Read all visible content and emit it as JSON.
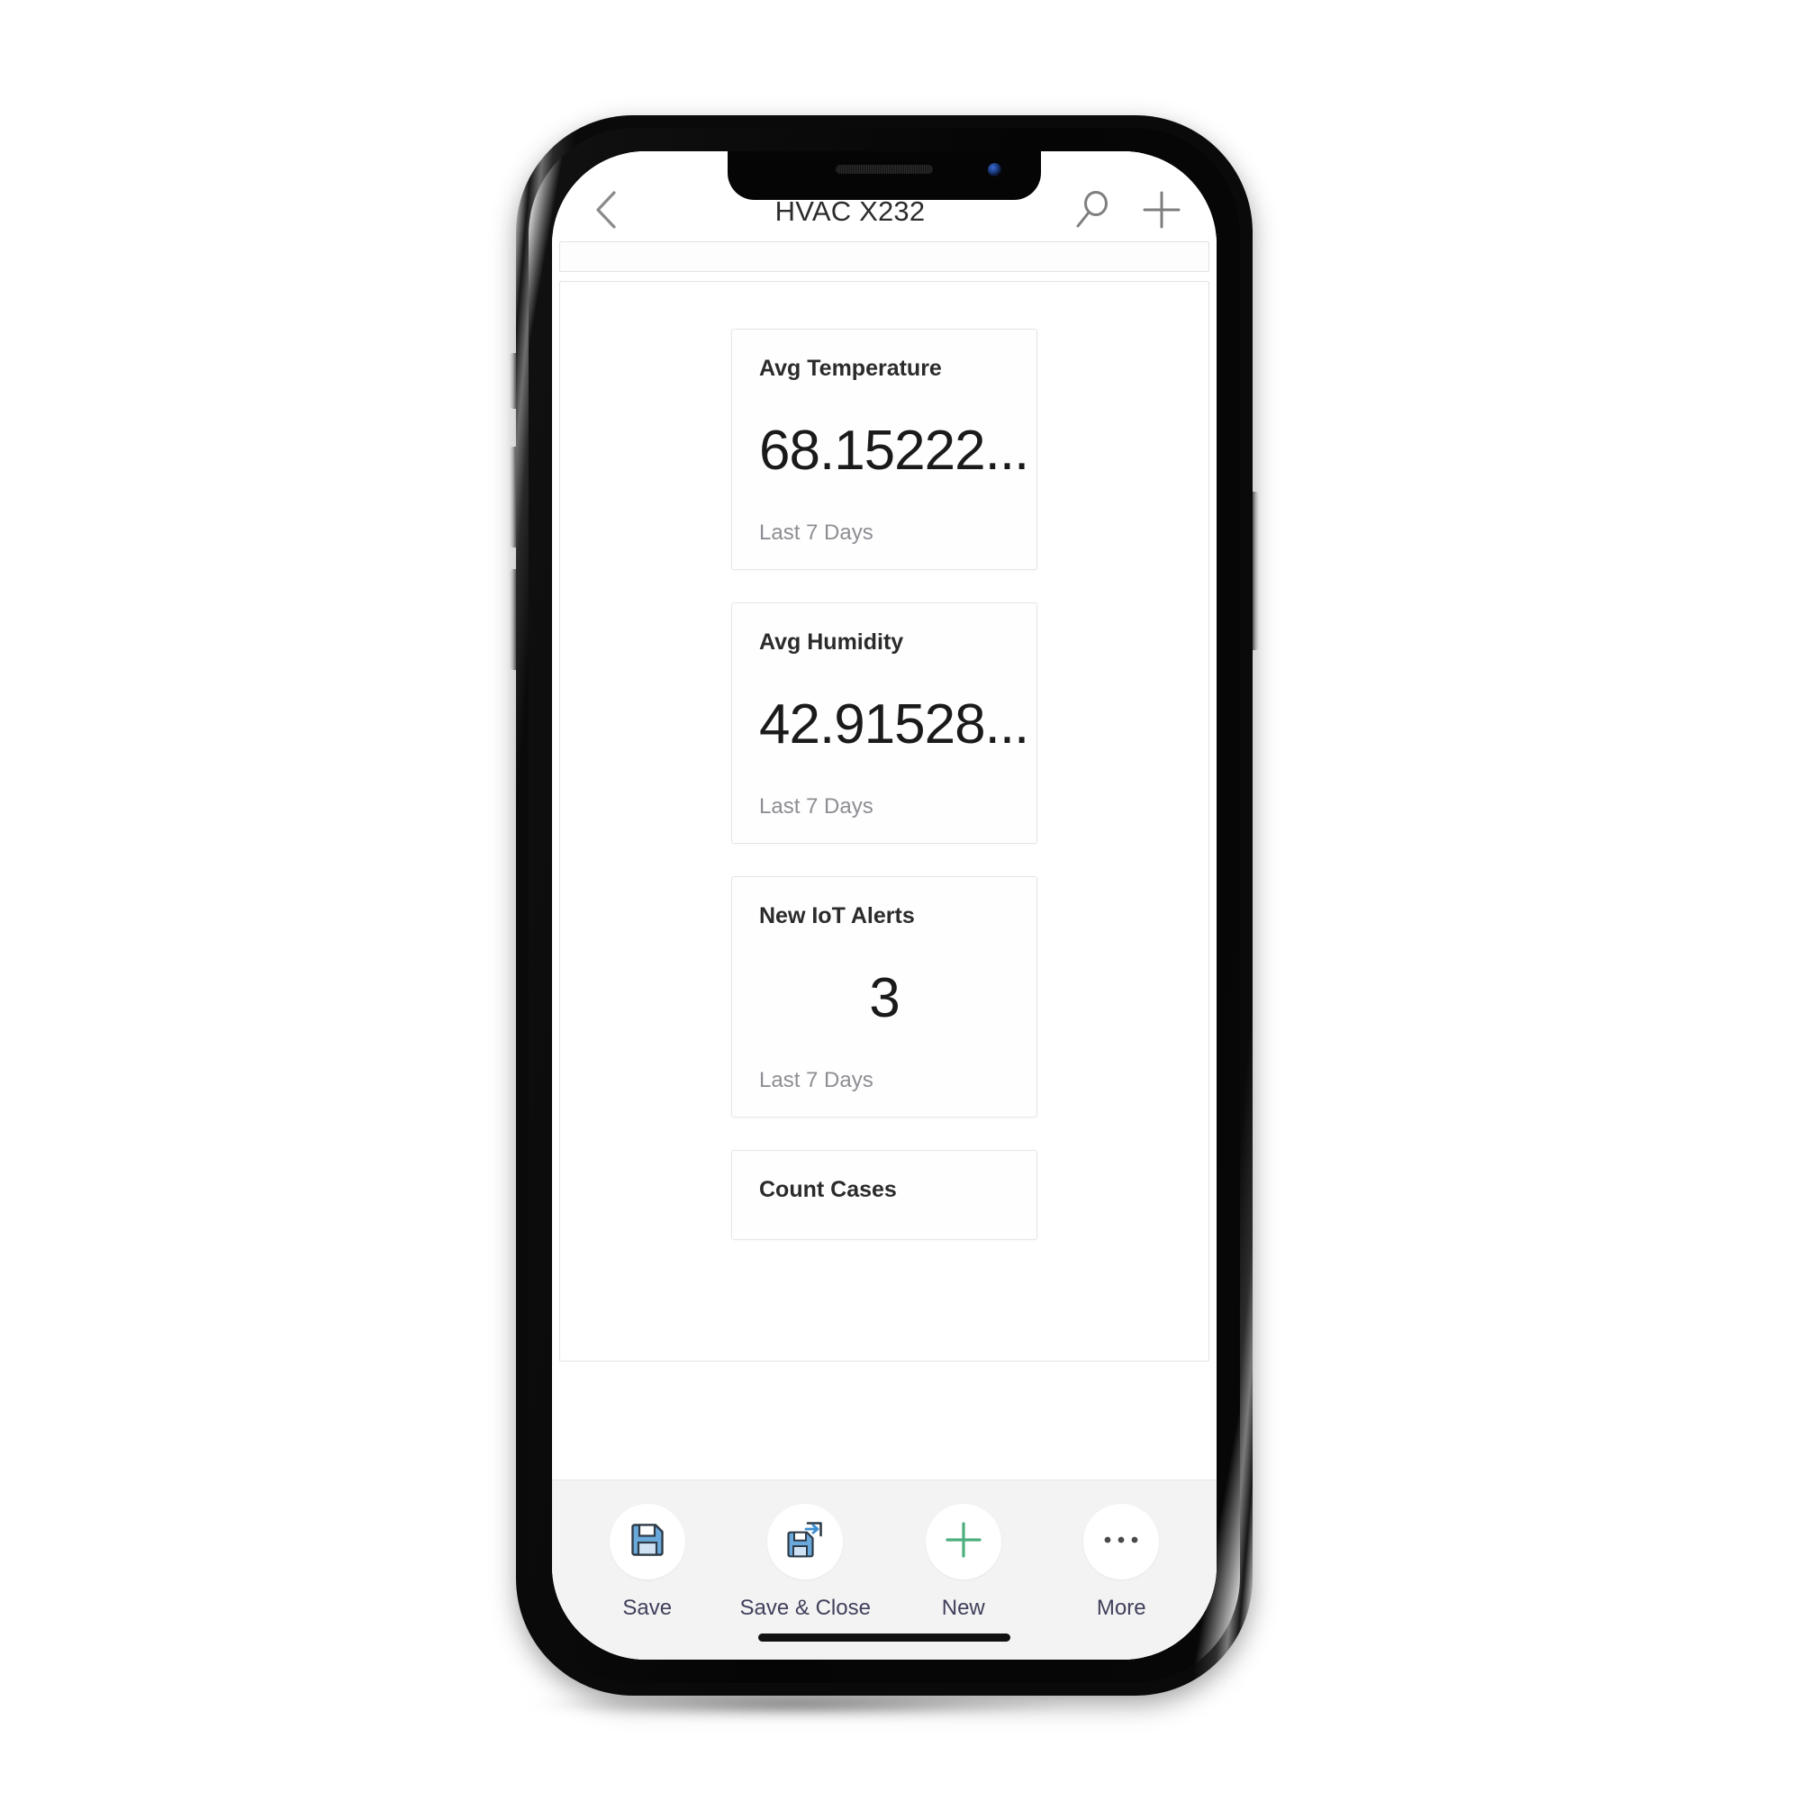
{
  "navbar": {
    "back_icon": "chevron-left-icon",
    "title": "HVAC X232",
    "search_icon": "search-icon",
    "add_icon": "plus-icon"
  },
  "dashboard": {
    "cards": [
      {
        "title": "Avg Temperature",
        "value": "68.15222...",
        "footer": "Last 7 Days",
        "align": "left"
      },
      {
        "title": "Avg Humidity",
        "value": "42.91528...",
        "footer": "Last 7 Days",
        "align": "left"
      },
      {
        "title": "New IoT Alerts",
        "value": "3",
        "footer": "Last 7 Days",
        "align": "center"
      },
      {
        "title": "Count Cases",
        "value": "",
        "footer": "",
        "align": "left"
      }
    ]
  },
  "commandbar": {
    "items": [
      {
        "label": "Save",
        "icon": "save-floppy-icon"
      },
      {
        "label": "Save & Close",
        "icon": "save-and-close-floppy-icon"
      },
      {
        "label": "New",
        "icon": "plus-icon"
      },
      {
        "label": "More",
        "icon": "ellipsis-icon"
      }
    ]
  },
  "colors": {
    "save_blue": "#5a9bd5",
    "new_green": "#4caf7d",
    "label_navy": "#40405c",
    "card_border": "#e6e6e8",
    "muted_text": "#8d8d93"
  }
}
